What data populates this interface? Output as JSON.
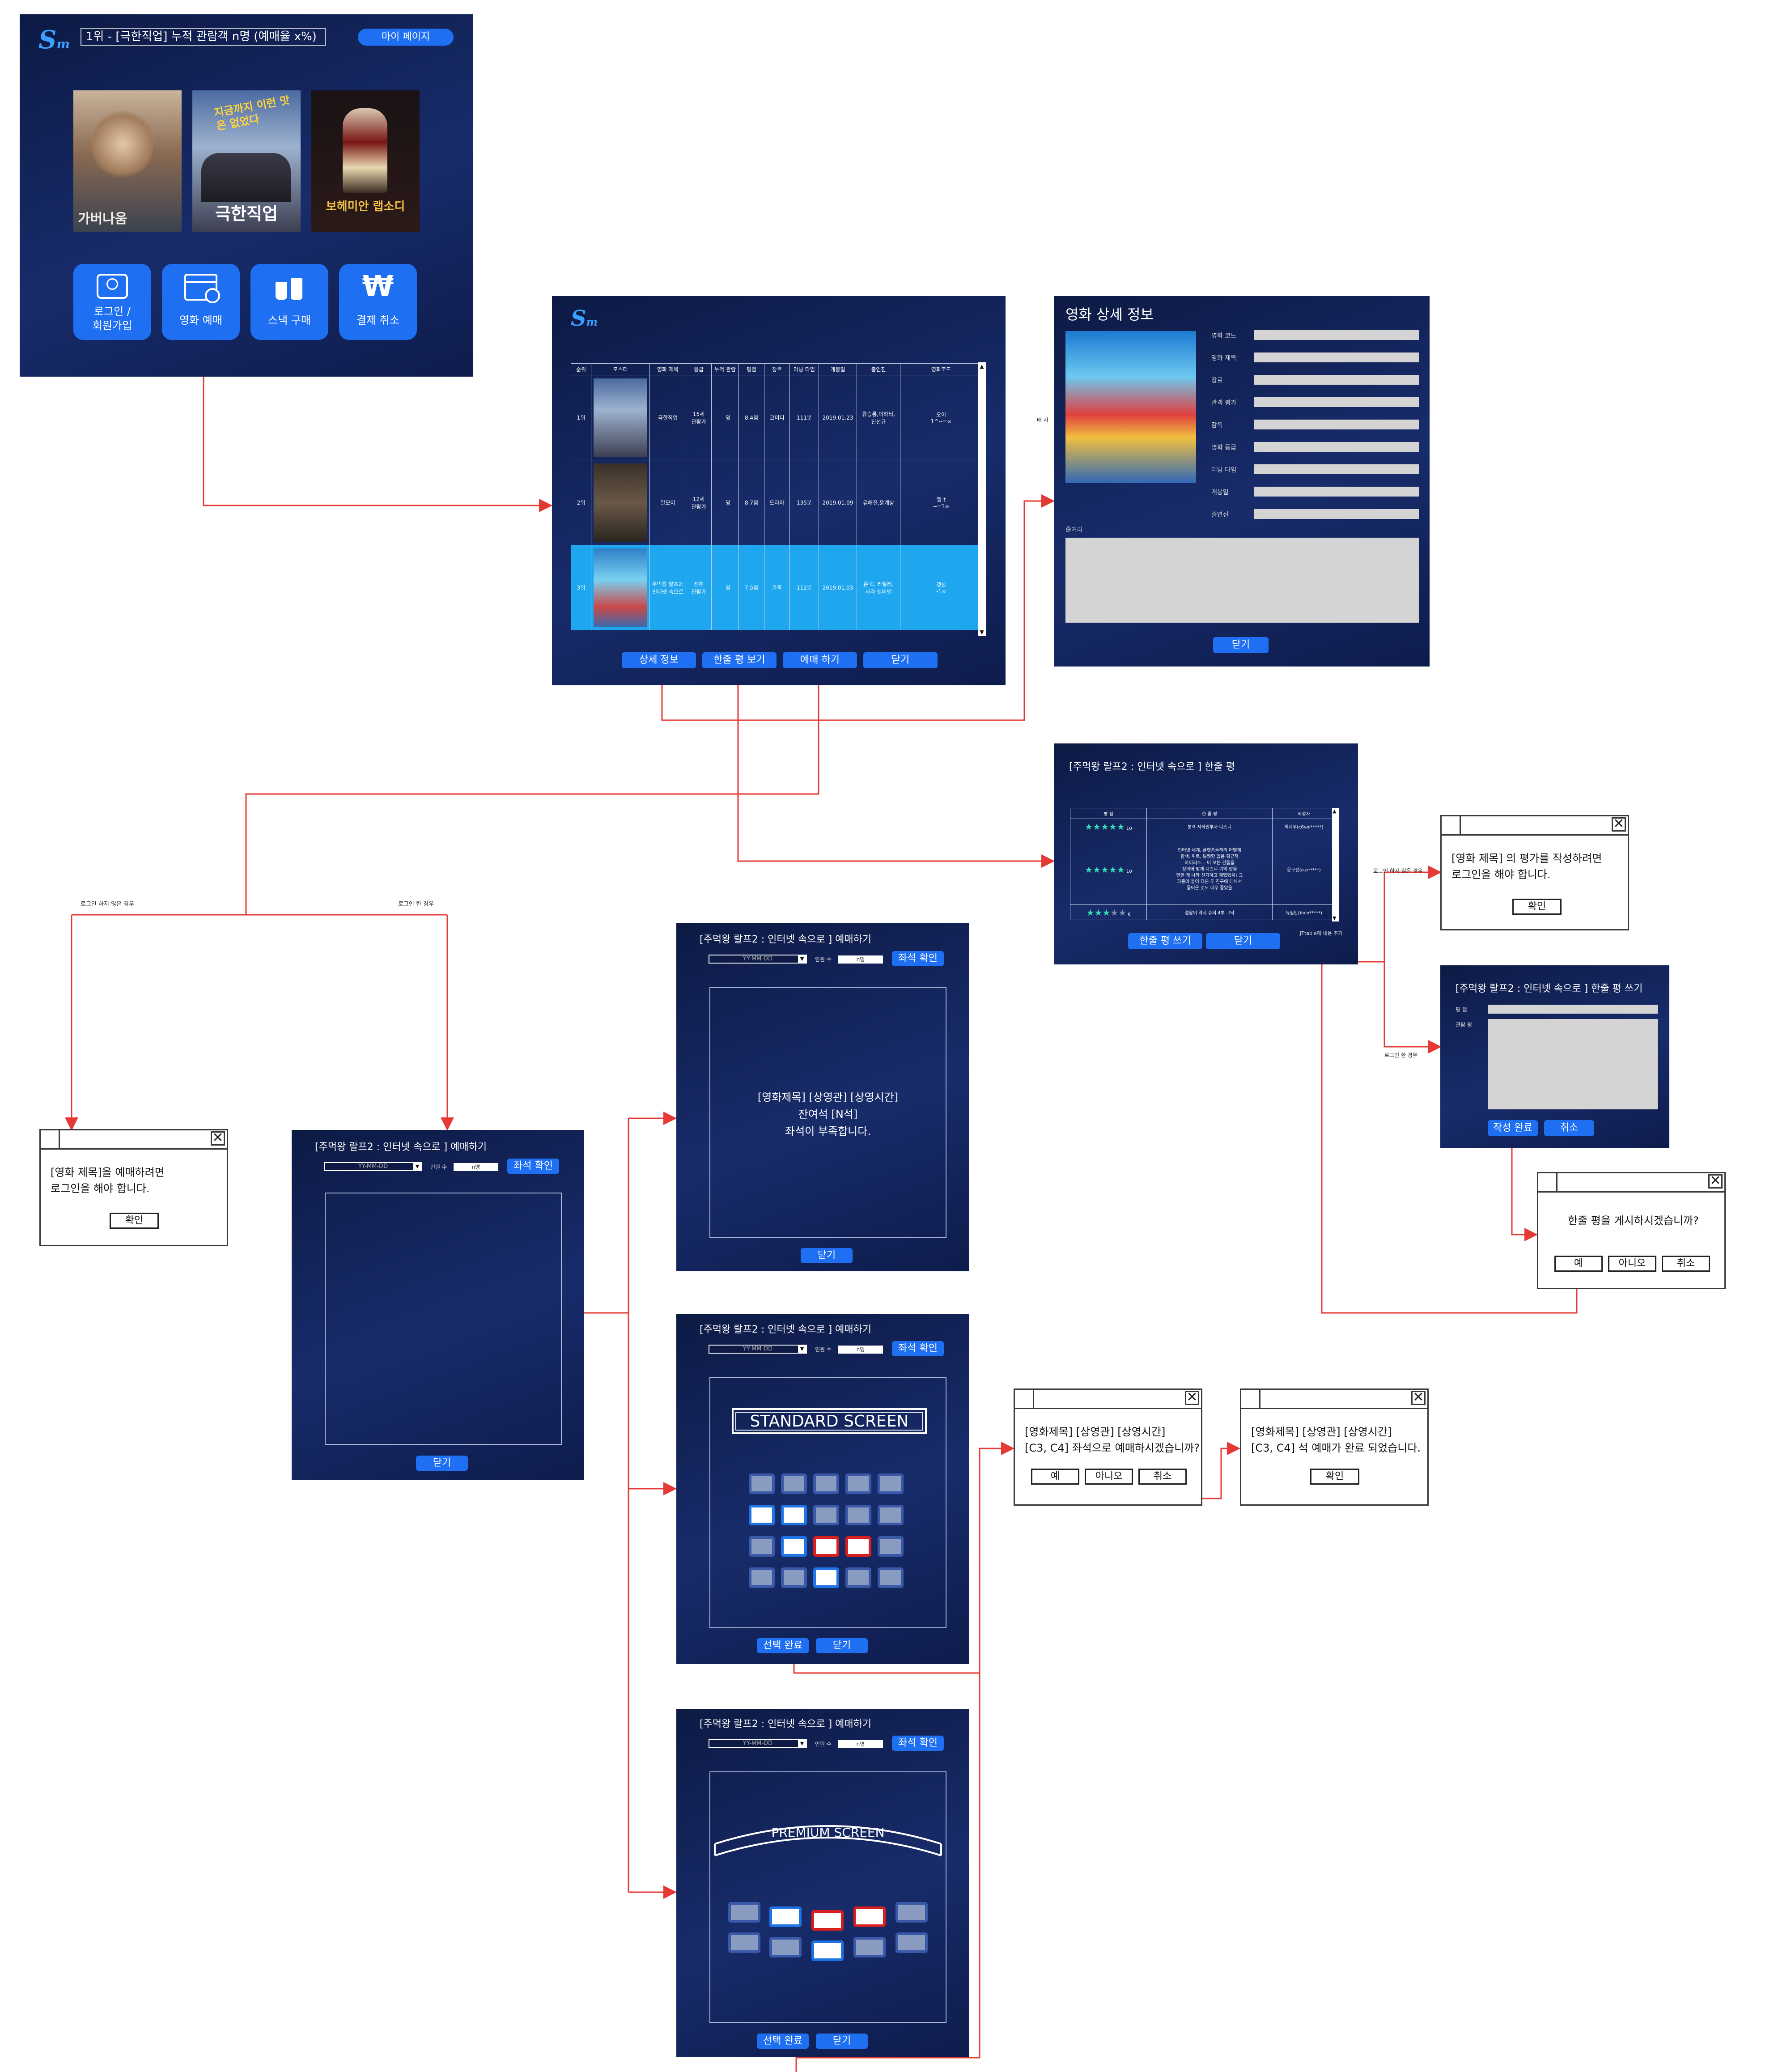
{
  "home": {
    "logo": "S",
    "logo_sub": "m",
    "ranking": "1위 - [극한직업] 누적 관람객 n명 (예매율 x%)",
    "mypage": "마이 페이지",
    "posters": [
      {
        "title": "가버나움"
      },
      {
        "title": "극한직업",
        "tagline": "지금까지 이런 맛은 없었다"
      },
      {
        "title": "보헤미안 랩소디"
      }
    ],
    "buttons": [
      {
        "label": "로그인 /\n회원가입",
        "icon": "person-card-icon"
      },
      {
        "label": "영화 예매",
        "icon": "clapperboard-icon"
      },
      {
        "label": "스낵 구매",
        "icon": "snack-drink-icon"
      },
      {
        "label": "결제 취소",
        "icon": "won-icon"
      }
    ]
  },
  "list": {
    "headers": [
      "순위",
      "포스터",
      "영화 제목",
      "등급",
      "누적 관람",
      "평점",
      "장르",
      "러닝 타임",
      "개봉일",
      "출연진",
      "영화코드"
    ],
    "rows": [
      {
        "rank": "1위",
        "title": "극한직업",
        "grade": "15세\n관람가",
        "total": "---명",
        "score": "8.4점",
        "genre": "코미디",
        "runtime": "111분",
        "date": "2019.01.23",
        "cast": "류승룡,이하늬,\n진선규",
        "code": "오이\n1^--=∞"
      },
      {
        "rank": "2위",
        "title": "말모이",
        "grade": "12세\n관람가",
        "total": "---명",
        "score": "8.7점",
        "genre": "드라마",
        "runtime": "135분",
        "date": "2019.01.09",
        "cast": "유해진,윤계상",
        "code": "앱-t\n--=1∞"
      },
      {
        "rank": "3위",
        "title": "주먹왕 랄프2:\n인터넷 속으로",
        "grade": "전체\n관람가",
        "total": "---명",
        "score": "7.5점",
        "genre": "가족",
        "runtime": "112분",
        "date": "2019.01.03",
        "cast": "존 C. 라일리,\n사라 실버맨",
        "code": "갱신\n-1∞"
      }
    ],
    "buttons": [
      "상세 정보",
      "한줄 평 보기",
      "예매 하기",
      "닫기"
    ]
  },
  "detail": {
    "title": "영화 상세 정보",
    "fields": [
      "영화 코드",
      "영화 제목",
      "장르",
      "관객 평가",
      "감독",
      "영화 등급",
      "러닝 타임",
      "개봉일",
      "출연진"
    ],
    "plot_label": "줄거리",
    "close": "닫기",
    "side_note": "배 사"
  },
  "reviews": {
    "title": "[주먹왕 랄프2 : 인터넷 속으로 ] 한줄 평",
    "headers": [
      "평 점",
      "한 줄 평",
      "작성자"
    ],
    "rows": [
      {
        "stars": 5,
        "score": "10",
        "text": "분격 저작권부자 디즈니",
        "author": "최지우(c8vol*****)"
      },
      {
        "stars": 5,
        "score": "10",
        "text": "인터넷 세계, 플랫폼들끼리 어떻게\n탐색, 위트, 통쾌함 없음 평균적\n바이러스... 이 모든 건들을\n정의에 맞게 디즈니 기억 잡을\n만한 게 나와 신기하고 재밌었음! 그\n파충에 들어 다른 두 친구에 대해서\n들어온 것도 너무 좋았음",
        "author": "윤구진(o.o*****)"
      },
      {
        "stars": 3,
        "score": "6",
        "text": "결말이 약지 슈퍼 4부 그닥",
        "author": "뉴일만(bolo*****)"
      }
    ],
    "note": "JTtable에 내용 추가",
    "buttons": [
      "한줄 평 쓰기",
      "닫기"
    ]
  },
  "labels": {
    "not_logged": "로그인 하지 않은 경우",
    "logged": "로그인 한 경우",
    "not_logged2": "로그인 하지 않은 경우",
    "logged2": "로그인 한 경우"
  },
  "login_review_dlg": {
    "msg": "[영화 제목] 의 평가를 작성하려면\n로그인을 해야 합니다.",
    "ok": "확인"
  },
  "write_review": {
    "title": "[주먹왕 랄프2 : 인터넷 속으로 ] 한줄 평 쓰기",
    "score_label": "평 점",
    "review_label": "관람 평",
    "buttons": [
      "작성 완료",
      "취소"
    ]
  },
  "post_confirm": {
    "msg": "한줄 평을 게시하시겠습니까?",
    "buttons": [
      "예",
      "아니오",
      "취소"
    ]
  },
  "login_book_dlg": {
    "msg": "[영화 제목]을 예매하려면\n로그인을 해야 합니다.",
    "ok": "확인"
  },
  "booking": {
    "title": "[주먹왕 랄프2 : 인터넷 속으로 ] 예매하기",
    "date_placeholder": "YY-MM-DD",
    "count_label": "인원 수",
    "count_value": "n명",
    "check": "좌석 확인",
    "close": "닫기",
    "select_done": "선택 완료",
    "full_msg": "[영화제목] [상영관] [상영시간]\n잔여석 [N석]\n좌석이 부족합니다.",
    "standard_screen": "STANDARD SCREEN",
    "premium_screen": "PREMIUM SCREEN",
    "standard_seats": [
      [
        "n",
        "n",
        "n",
        "n",
        "n"
      ],
      [
        "s",
        "s",
        "n",
        "n",
        "n"
      ],
      [
        "n",
        "s",
        "r",
        "r",
        "n"
      ],
      [
        "n",
        "n",
        "s",
        "n",
        "n"
      ]
    ]
  },
  "seat_confirm": {
    "msg": "[영화제목] [상영관] [상영시간]\n[C3, C4] 좌석으로 예매하시겠습니까?",
    "buttons": [
      "예",
      "아니오",
      "취소"
    ]
  },
  "booking_done": {
    "msg": "[영화제목] [상영관] [상영시간]\n[C3, C4] 석 예매가 완료 되었습니다.",
    "ok": "확인"
  },
  "colors": {
    "arrow": "#e53935",
    "accent": "#1f6ff2",
    "highlight_row": "#1ea7ef",
    "panel": "#14275e"
  }
}
